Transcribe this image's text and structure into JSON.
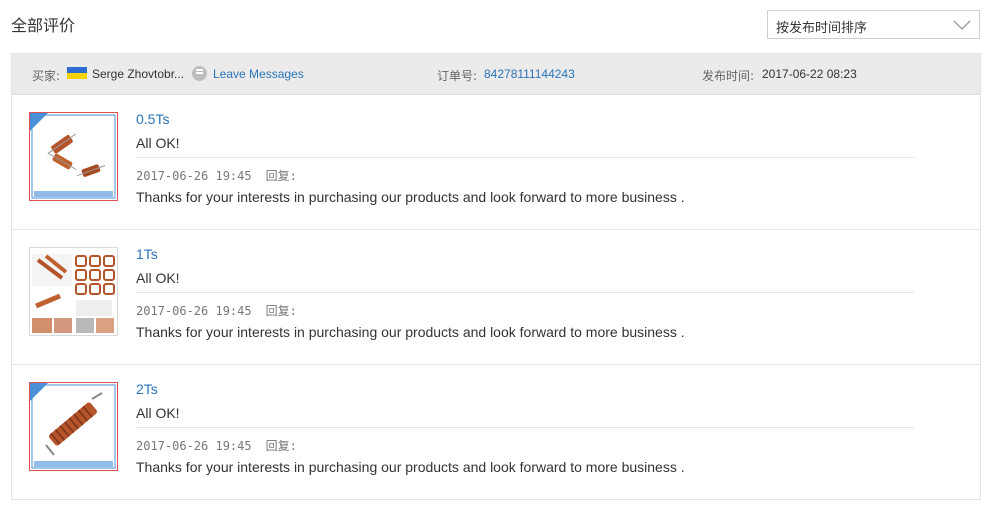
{
  "page": {
    "title": "全部评价"
  },
  "sort": {
    "selected": "按发布时间排序"
  },
  "header": {
    "buyer_label": "买家:",
    "buyer_name": "Serge Zhovtobr...",
    "leave_messages": "Leave Messages",
    "order_label": "订单号:",
    "order_number": "84278111144243",
    "time_label": "发布时间:",
    "time_value": "2017-06-22 08:23"
  },
  "reviews": [
    {
      "name": "0.5Ts",
      "comment": "All OK!",
      "reply_date": "2017-06-26 19:45",
      "reply_label": "回复:",
      "reply_text": "Thanks for your interests in purchasing our products and look forward to more business ."
    },
    {
      "name": "1Ts",
      "comment": "All OK!",
      "reply_date": "2017-06-26 19:45",
      "reply_label": "回复:",
      "reply_text": "Thanks for your interests in purchasing our products and look forward to more business ."
    },
    {
      "name": "2Ts",
      "comment": "All OK!",
      "reply_date": "2017-06-26 19:45",
      "reply_label": "回复:",
      "reply_text": "Thanks for your interests in purchasing our products and look forward to more business ."
    }
  ],
  "colors": {
    "link": "#2a74b8",
    "header_bg": "#ebebeb",
    "flag_blue": "#2e6bd1",
    "flag_yellow": "#f5d300"
  },
  "icons": {
    "sort": "chevron-down-icon",
    "message": "message-icon",
    "flag": "ukraine-flag-icon"
  }
}
